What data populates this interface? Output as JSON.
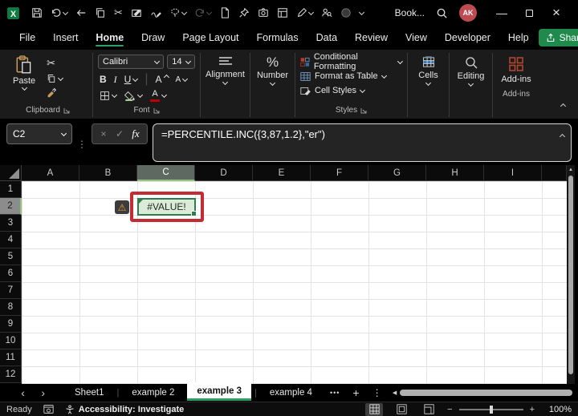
{
  "titlebar": {
    "workbook_name": "Book...",
    "avatar_initials": "AK",
    "qat_icon_names": [
      "excel-logo",
      "save",
      "undo",
      "back",
      "copy",
      "cut",
      "draw-ink",
      "ink-annotate",
      "lasso-select",
      "redo",
      "new-file",
      "pin",
      "camera",
      "form",
      "edit-signature",
      "people-lookup",
      "record",
      "qat-overflow"
    ]
  },
  "menubar": {
    "tabs": [
      "File",
      "Insert",
      "Home",
      "Draw",
      "Page Layout",
      "Formulas",
      "Data",
      "Review",
      "View",
      "Developer",
      "Help"
    ],
    "active_tab": "Home",
    "share_label": "Share"
  },
  "ribbon": {
    "clipboard": {
      "group_label": "Clipboard",
      "paste_label": "Paste"
    },
    "font": {
      "group_label": "Font",
      "font_family": "Calibri",
      "font_size": "14",
      "bold": "B",
      "italic": "I",
      "underline": "U",
      "increase_font": "A",
      "decrease_font": "A"
    },
    "alignment": {
      "label": "Alignment"
    },
    "number": {
      "label": "Number"
    },
    "styles": {
      "group_label": "Styles",
      "conditional_formatting": "Conditional Formatting",
      "format_as_table": "Format as Table",
      "cell_styles": "Cell Styles"
    },
    "cells": {
      "label": "Cells"
    },
    "editing": {
      "label": "Editing"
    },
    "addins": {
      "button_label": "Add-ins",
      "group_label": "Add-ins"
    }
  },
  "formula_bar": {
    "name_box_value": "C2",
    "formula": "=PERCENTILE.INC({3,87,1.2},\"er\")",
    "fx_label": "fx"
  },
  "grid": {
    "column_headers": [
      "A",
      "B",
      "C",
      "D",
      "E",
      "F",
      "G",
      "H",
      "I"
    ],
    "row_headers": [
      "1",
      "2",
      "3",
      "4",
      "5",
      "6",
      "7",
      "8",
      "9",
      "10",
      "11",
      "12"
    ],
    "selected_column": "C",
    "selected_row": "2",
    "active_cell": {
      "ref": "C2",
      "value": "#VALUE!"
    },
    "colors": {
      "cell_fill": "#dcead8",
      "cell_border": "#2f7d4f",
      "annotation_red": "#c42c33",
      "accent_green": "#1f8a4c",
      "header_selected": "#5e6a61"
    }
  },
  "sheet_bar": {
    "tabs": [
      "Sheet1",
      "example 2",
      "example 3",
      "example 4"
    ],
    "active_tab": "example 3"
  },
  "status_bar": {
    "mode": "Ready",
    "accessibility": "Accessibility: Investigate",
    "zoom_level": "100%"
  },
  "icons": {
    "warning": "⚠",
    "scissors": "✂",
    "check": "✓",
    "cancel": "×",
    "dots_vertical": "⋮",
    "more_sheets": "•••",
    "add_sheet": "+",
    "nav_left": "‹",
    "nav_right": "›",
    "scroll_up": "▲",
    "scroll_left": "◀",
    "scroll_right": "▶",
    "zoom_minus": "−",
    "zoom_plus": "+",
    "percent": "%",
    "close": "×",
    "minimize": "—"
  }
}
